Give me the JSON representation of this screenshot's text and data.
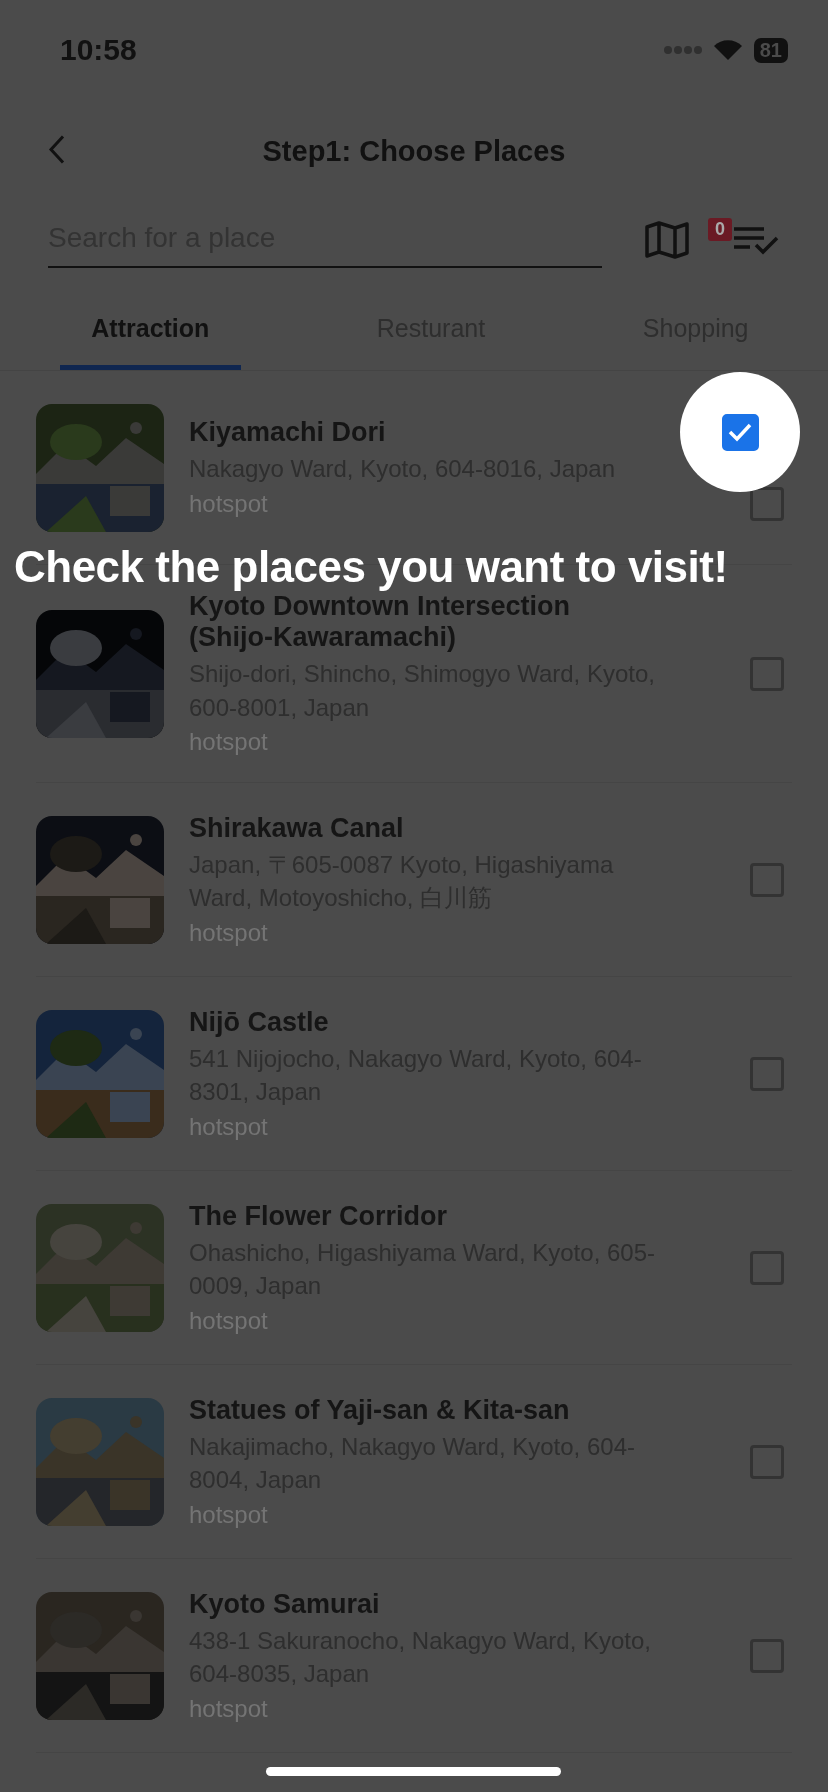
{
  "status_bar": {
    "time": "10:58",
    "battery": "81"
  },
  "header": {
    "title": "Step1: Choose Places"
  },
  "search": {
    "placeholder": "Search for a place"
  },
  "selected_badge": "0",
  "tabs": [
    {
      "label": "Attraction",
      "selected": true
    },
    {
      "label": "Resturant",
      "selected": false
    },
    {
      "label": "Shopping",
      "selected": false
    }
  ],
  "places": [
    {
      "name": "Kiyamachi Dori",
      "address": "Nakagyo Ward, Kyoto, 604-8016, Japan",
      "tag": "hotspot",
      "checked": false
    },
    {
      "name": "Kyoto Downtown Intersection (Shijo-Kawaramachi)",
      "address": "Shijo-dori, Shincho, Shimogyo Ward, Kyoto, 600-8001, Japan",
      "tag": "hotspot",
      "checked": false
    },
    {
      "name": "Shirakawa Canal",
      "address": "Japan, 〒605-0087 Kyoto, Higashiyama Ward, Motoyoshicho, 白川筋",
      "tag": "hotspot",
      "checked": false
    },
    {
      "name": "Nijō Castle",
      "address": "541 Nijojocho, Nakagyo Ward, Kyoto, 604-8301, Japan",
      "tag": "hotspot",
      "checked": false
    },
    {
      "name": "The Flower Corridor",
      "address": "Ohashicho, Higashiyama Ward, Kyoto, 605-0009, Japan",
      "tag": "hotspot",
      "checked": false
    },
    {
      "name": "Statues of Yaji-san & Kita-san",
      "address": "Nakajimacho, Nakagyo Ward, Kyoto, 604-8004, Japan",
      "tag": "hotspot",
      "checked": false
    },
    {
      "name": "Kyoto Samurai",
      "address": "438-1 Sakuranocho, Nakagyo Ward, Kyoto, 604-8035, Japan",
      "tag": "hotspot",
      "checked": false
    }
  ],
  "tutorial": {
    "text": "Check the places you want to visit!",
    "checked": true
  }
}
